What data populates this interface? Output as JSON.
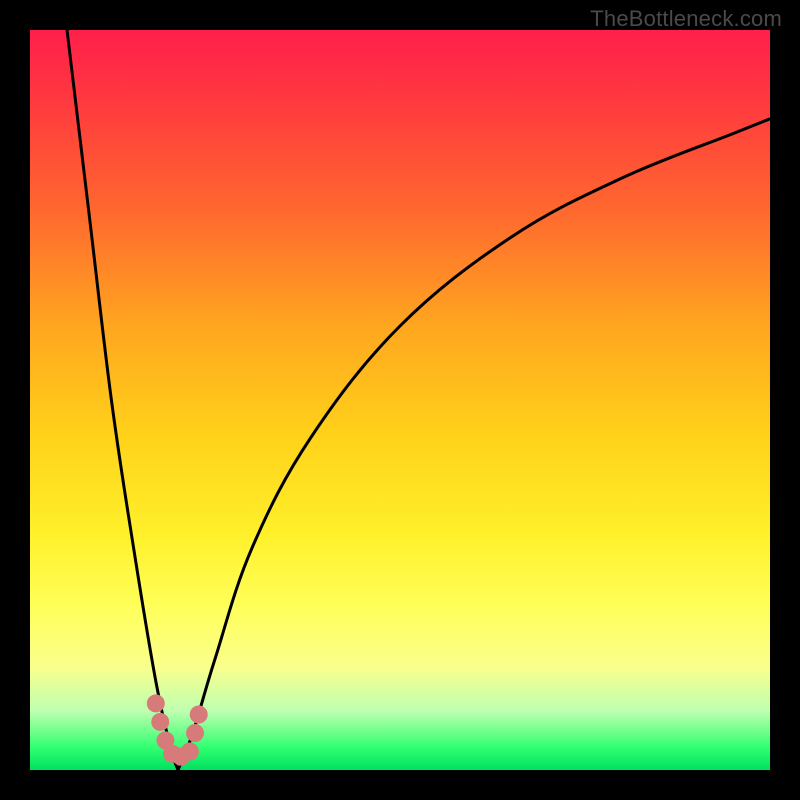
{
  "watermark": "TheBottleneck.com",
  "colors": {
    "background": "#000000",
    "curve": "#000000",
    "marker": "#d77a7a",
    "gradient_top": "#ff1f4b",
    "gradient_bottom": "#00e060"
  },
  "chart_data": {
    "type": "line",
    "title": "",
    "xlabel": "",
    "ylabel": "",
    "xlim": [
      0,
      100
    ],
    "ylim": [
      0,
      100
    ],
    "grid": false,
    "legend": false,
    "description": "Two black curves descending from high bottleneck (red) toward a minimum near x≈20 (green) then rising again; pink markers cluster near the trough.",
    "series": [
      {
        "name": "curve-left",
        "x": [
          5,
          8,
          11,
          14,
          17,
          19,
          20
        ],
        "y": [
          100,
          75,
          50,
          30,
          12,
          3,
          0
        ]
      },
      {
        "name": "curve-right",
        "x": [
          20,
          22,
          25,
          30,
          38,
          50,
          65,
          80,
          95,
          100
        ],
        "y": [
          0,
          5,
          15,
          30,
          45,
          60,
          72,
          80,
          86,
          88
        ]
      }
    ],
    "markers": [
      {
        "x": 17.0,
        "y": 9.0
      },
      {
        "x": 17.6,
        "y": 6.5
      },
      {
        "x": 18.3,
        "y": 4.0
      },
      {
        "x": 19.2,
        "y": 2.2
      },
      {
        "x": 20.4,
        "y": 1.8
      },
      {
        "x": 21.6,
        "y": 2.5
      },
      {
        "x": 22.3,
        "y": 5.0
      },
      {
        "x": 22.8,
        "y": 7.5
      }
    ]
  }
}
